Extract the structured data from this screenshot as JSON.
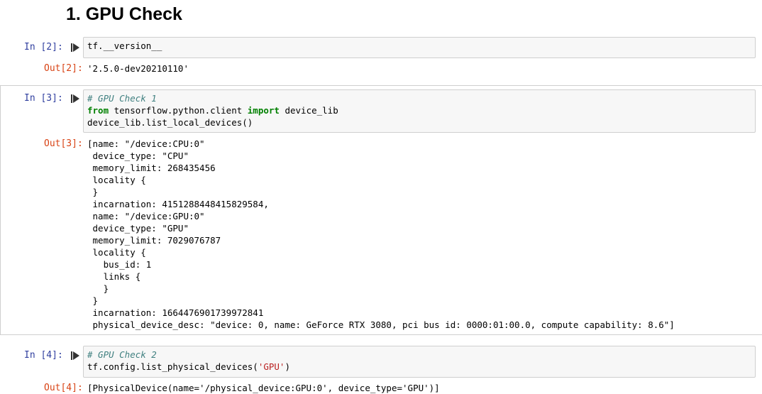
{
  "heading": "1. GPU Check",
  "cells": [
    {
      "in_prompt": "In [2]:",
      "out_prompt": "Out[2]:",
      "code": "tf.__version__",
      "output": "'2.5.0-dev20210110'"
    },
    {
      "in_prompt": "In [3]:",
      "out_prompt": "Out[3]:",
      "code_comment": "# GPU Check 1",
      "code_kw_from": "from",
      "code_module": " tensorflow.python.client ",
      "code_kw_import": "import",
      "code_name": " device_lib",
      "code_line3": "device_lib.list_local_devices()",
      "output_lines": [
        "[name: \"/device:CPU:0\"",
        " device_type: \"CPU\"",
        " memory_limit: 268435456",
        " locality {",
        " }",
        " incarnation: 4151288448415829584,",
        " name: \"/device:GPU:0\"",
        " device_type: \"GPU\"",
        " memory_limit: 7029076787",
        " locality {",
        "   bus_id: 1",
        "   links {",
        "   }",
        " }",
        " incarnation: 1664476901739972841",
        " physical_device_desc: \"device: 0, name: GeForce RTX 3080, pci bus id: 0000:01:00.0, compute capability: 8.6\"]"
      ]
    },
    {
      "in_prompt": "In [4]:",
      "out_prompt": "Out[4]:",
      "code_comment": "# GPU Check 2",
      "code_pre": "tf.config.list_physical_devices(",
      "code_str": "'GPU'",
      "code_post": ")",
      "output": "[PhysicalDevice(name='/physical_device:GPU:0', device_type='GPU')]"
    }
  ],
  "colors": {
    "in_prompt": "#303f9f",
    "out_prompt": "#d84315",
    "comment": "#408080",
    "keyword": "#008000",
    "string": "#ba2121"
  },
  "icons": {
    "run": "run-cell-icon"
  }
}
